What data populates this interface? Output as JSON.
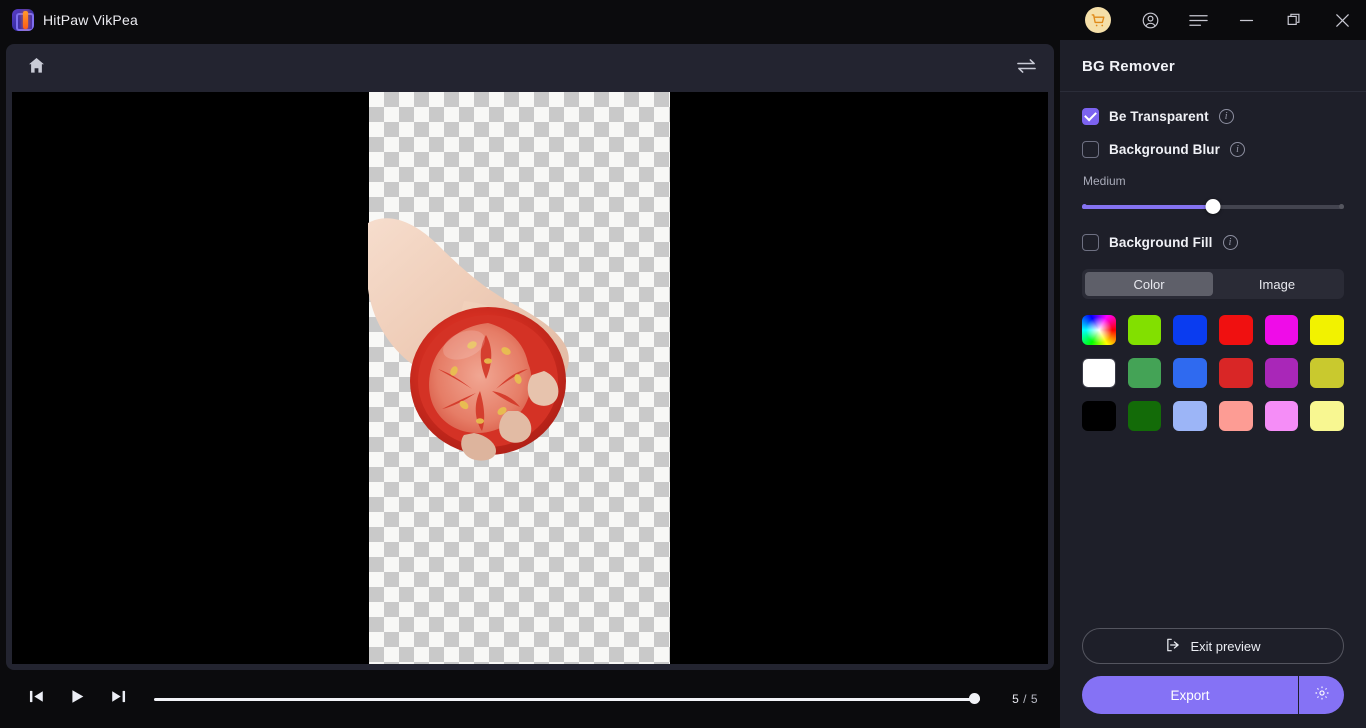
{
  "titlebar": {
    "app_name": "HitPaw VikPea",
    "logo_icon": "hitpaw-logo-icon",
    "cart_icon": "shopping-cart-icon",
    "account_icon": "user-account-icon",
    "menu_icon": "hamburger-menu-icon",
    "minimize_icon": "minimize-icon",
    "maximize_icon": "restore-window-icon",
    "close_icon": "close-icon"
  },
  "editor": {
    "home_icon": "home-icon",
    "compare_icon": "compare-swap-icon",
    "canvas": {
      "background": "#000000",
      "transparency_checker_light": "#f8f8f6",
      "transparency_checker_dark": "#c9c9c9",
      "subject_description": "hand holding a sliced tomato"
    }
  },
  "playback": {
    "prev_frame_icon": "previous-frame-icon",
    "play_icon": "play-icon",
    "next_frame_icon": "next-frame-icon",
    "current_frame": "5",
    "separator": "/",
    "total_frames": "5",
    "progress_percent": 100
  },
  "panel": {
    "title": "BG Remover",
    "options": [
      {
        "label": "Be Transparent",
        "checked": true,
        "info_icon": "info-icon"
      },
      {
        "label": "Background Blur",
        "checked": false,
        "info_icon": "info-icon"
      }
    ],
    "blur": {
      "level_label": "Medium",
      "value_percent": 50,
      "fill_color": "#8573f2",
      "track_color": "#43444f"
    },
    "fill_option": {
      "label": "Background Fill",
      "checked": false,
      "info_icon": "info-icon"
    },
    "fill_tabs": [
      {
        "label": "Color",
        "active": true
      },
      {
        "label": "Image",
        "active": false
      }
    ],
    "swatches": [
      {
        "name": "color-picker",
        "color": "rainbow"
      },
      {
        "name": "swatch-chartreuse",
        "color": "#82e000"
      },
      {
        "name": "swatch-blue",
        "color": "#0a3cf0"
      },
      {
        "name": "swatch-red",
        "color": "#f01010"
      },
      {
        "name": "swatch-magenta",
        "color": "#ef0ce8"
      },
      {
        "name": "swatch-yellow",
        "color": "#f2f200"
      },
      {
        "name": "swatch-white",
        "color": "#ffffff"
      },
      {
        "name": "swatch-green",
        "color": "#44a356"
      },
      {
        "name": "swatch-royal-blue",
        "color": "#2f6af0"
      },
      {
        "name": "swatch-crimson",
        "color": "#d92626"
      },
      {
        "name": "swatch-purple",
        "color": "#a927b8"
      },
      {
        "name": "swatch-olive-yellow",
        "color": "#c9c92e"
      },
      {
        "name": "swatch-black",
        "color": "#000000"
      },
      {
        "name": "swatch-dark-green",
        "color": "#136b08"
      },
      {
        "name": "swatch-light-blue",
        "color": "#9cb5f7"
      },
      {
        "name": "swatch-salmon",
        "color": "#fd9c94"
      },
      {
        "name": "swatch-pink",
        "color": "#f58df7"
      },
      {
        "name": "swatch-pale-yellow",
        "color": "#f8f791"
      }
    ],
    "exit_preview": {
      "label": "Exit preview",
      "icon": "exit-icon"
    },
    "export": {
      "label": "Export",
      "settings_icon": "gear-icon",
      "color": "#8572f5"
    }
  }
}
